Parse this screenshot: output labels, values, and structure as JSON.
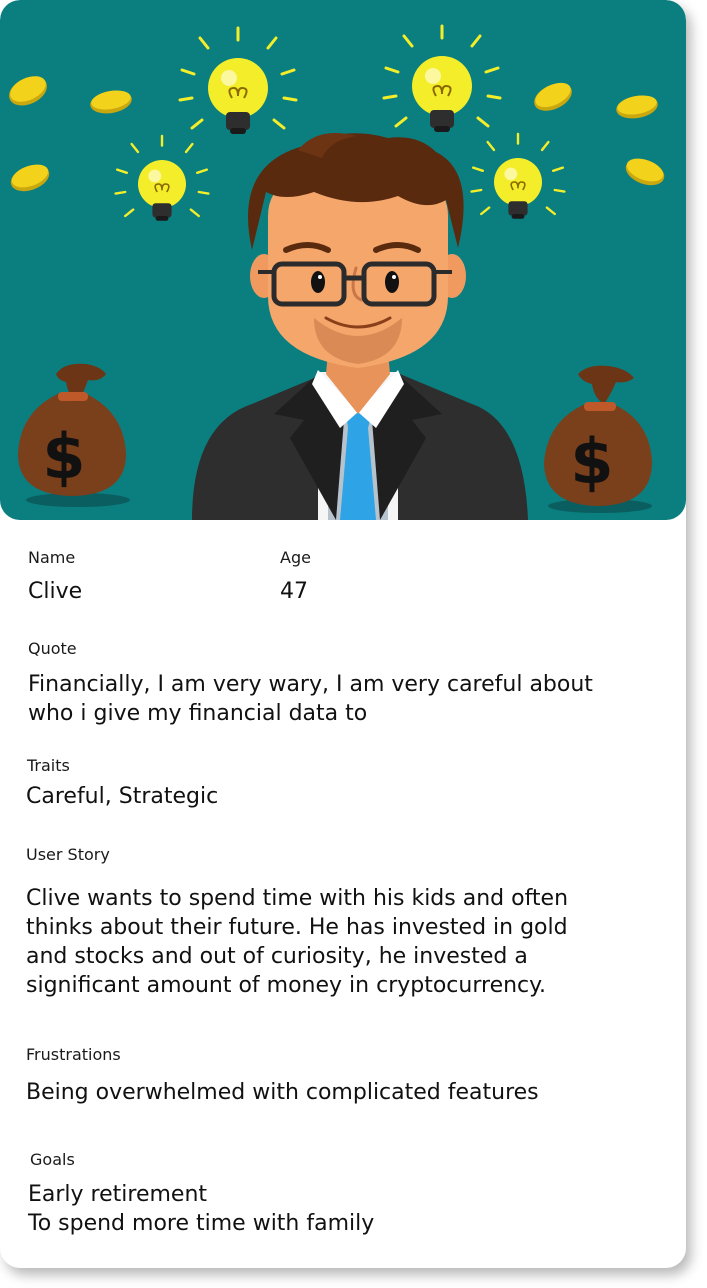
{
  "persona": {
    "name_label": "Name",
    "name": "Clive",
    "age_label": "Age",
    "age": "47",
    "quote_label": "Quote",
    "quote_lines": [
      "Financially, I am very wary, I am very careful about",
      "who i give my financial data to"
    ],
    "traits_label": "Traits",
    "traits": "Careful, Strategic",
    "story_label": "User Story",
    "story_lines": [
      "Clive wants to spend time with his kids and often",
      "thinks about their future. He has invested in gold",
      "and stocks and out of curiosity, he invested a",
      "significant amount of money in cryptocurrency."
    ],
    "frustrations_label": "Frustrations",
    "frustrations": "Being overwhelmed with complicated features",
    "goals_label": "Goals",
    "goals_lines": [
      "Early retirement",
      "To spend more time with family"
    ]
  },
  "illustration": {
    "money_symbol": "$",
    "colors": {
      "background": "#0b7f7f",
      "coin": "#f2d21b",
      "bulb": "#f4ee2a",
      "hair": "#5a2a0f",
      "skin": "#f5a66b",
      "suit": "#2e2e2e",
      "tie": "#2ea3e6",
      "bag": "#7a3f1b"
    },
    "icons": [
      "lightbulb-icon",
      "coin-icon",
      "money-bag-icon",
      "avatar"
    ]
  }
}
